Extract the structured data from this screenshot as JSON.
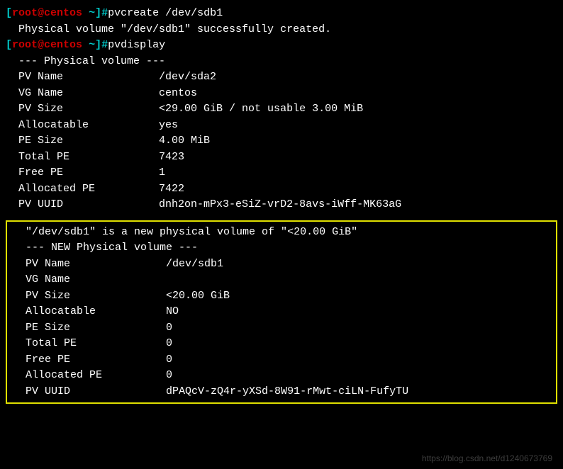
{
  "prompt": {
    "open_bracket": "[",
    "user": "root",
    "at": "@",
    "host": "centos",
    "space": " ",
    "path": "~",
    "close_bracket": "]",
    "hash": "#"
  },
  "cmd1": "pvcreate /dev/sdb1",
  "out1": "  Physical volume \"/dev/sdb1\" successfully created.",
  "cmd2": "pvdisplay",
  "pv1": {
    "header": "  --- Physical volume ---",
    "rows": [
      "  PV Name               /dev/sda2",
      "  VG Name               centos",
      "  PV Size               <29.00 GiB / not usable 3.00 MiB",
      "  Allocatable           yes",
      "  PE Size               4.00 MiB",
      "  Total PE              7423",
      "  Free PE               1",
      "  Allocated PE          7422",
      "  PV UUID               dnh2on-mPx3-eSiZ-vrD2-8avs-iWff-MK63aG"
    ]
  },
  "pv2": {
    "intro": "  \"/dev/sdb1\" is a new physical volume of \"<20.00 GiB\"",
    "header": "  --- NEW Physical volume ---",
    "rows": [
      "  PV Name               /dev/sdb1",
      "  VG Name               ",
      "  PV Size               <20.00 GiB",
      "  Allocatable           NO",
      "  PE Size               0",
      "  Total PE              0",
      "  Free PE               0",
      "  Allocated PE          0",
      "  PV UUID               dPAQcV-zQ4r-yXSd-8W91-rMwt-ciLN-FufyTU"
    ]
  },
  "watermark": "https://blog.csdn.net/d1240673769"
}
